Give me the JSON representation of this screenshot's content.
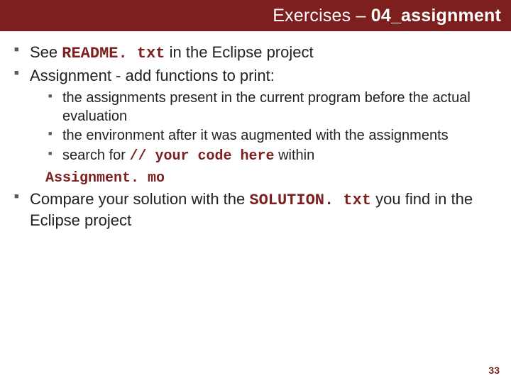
{
  "header": {
    "prefix": "Exercises – ",
    "bold": "04_assignment"
  },
  "bullets": {
    "b1": {
      "pre": "See ",
      "code": "README. txt",
      "post": " in the Eclipse project"
    },
    "b2": "Assignment - add functions to print:",
    "sub": {
      "s1": "the assignments present in the current program before the actual evaluation",
      "s2": "the environment after it was augmented with the assignments",
      "s3": {
        "pre": "search for ",
        "code": "// your code here",
        "post": " within"
      },
      "s3b": "Assignment. mo"
    },
    "b3": {
      "pre": "Compare your solution with the ",
      "code": "SOLUTION. txt",
      "post": " you find in the Eclipse project"
    }
  },
  "pageNumber": "33"
}
